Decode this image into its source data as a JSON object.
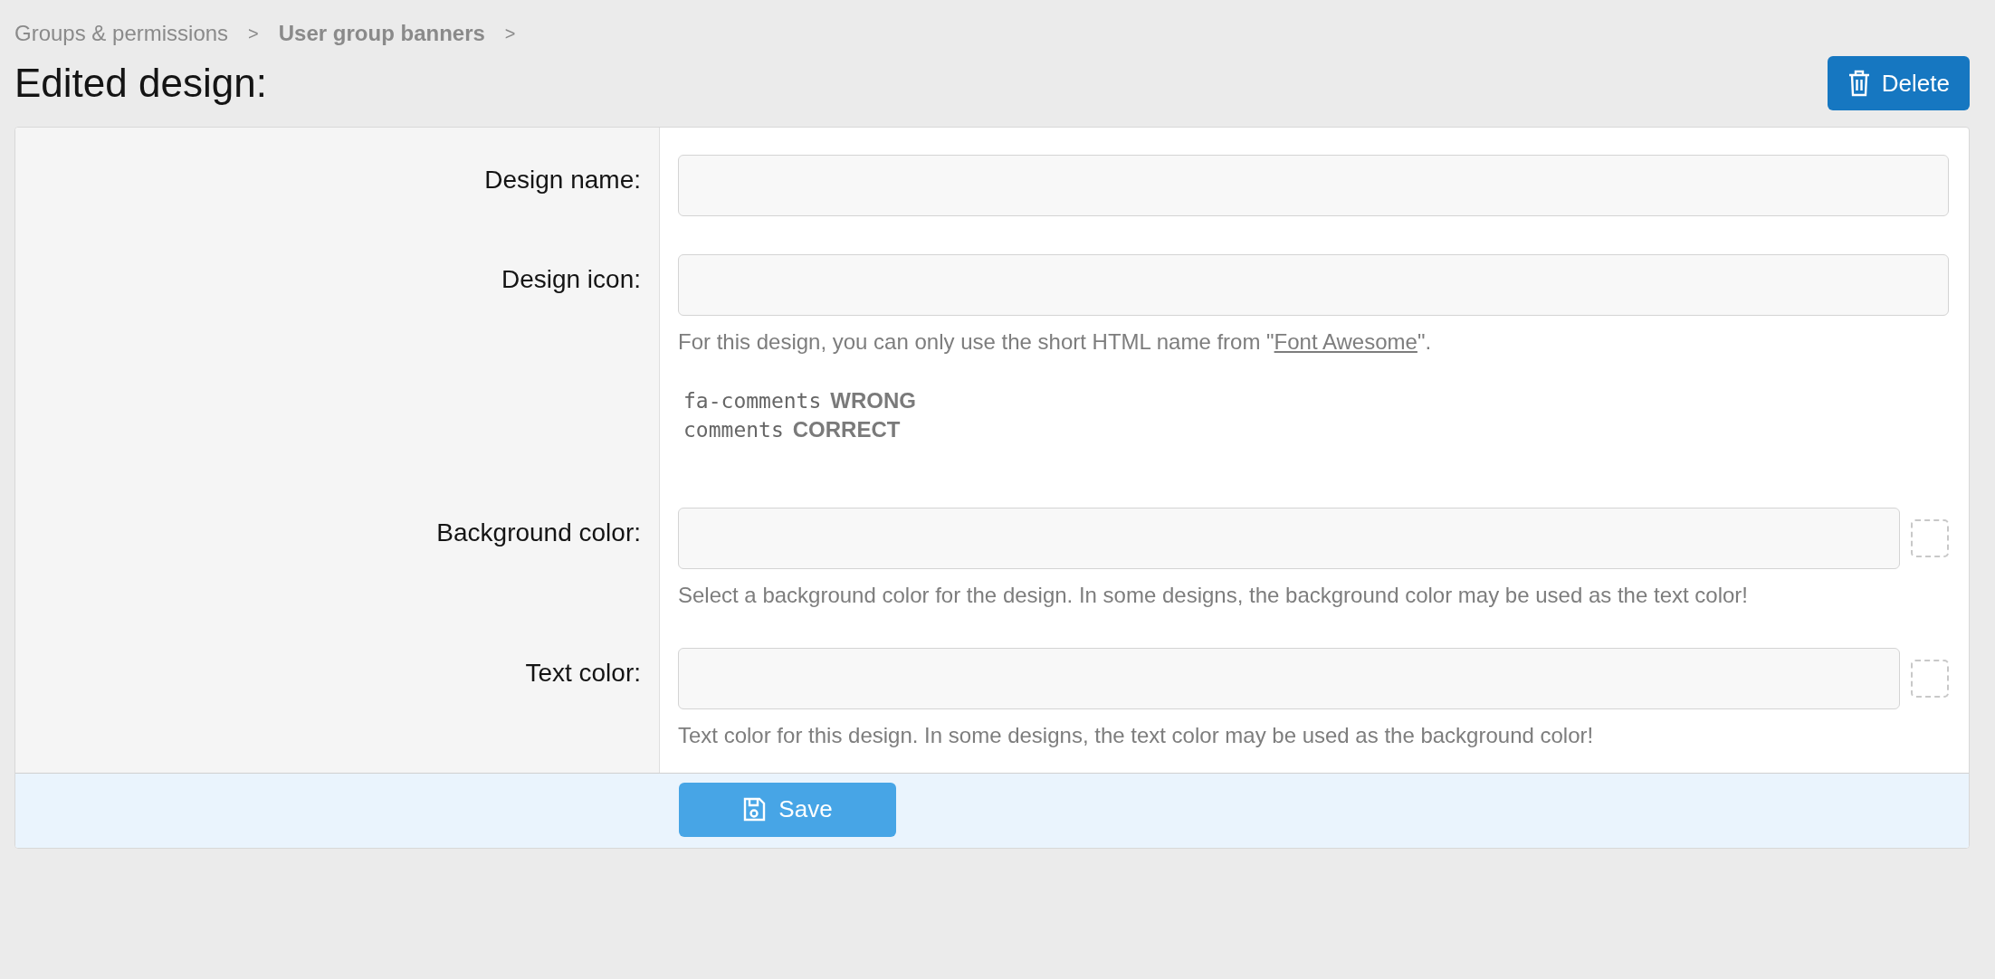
{
  "breadcrumbs": [
    {
      "label": "Groups & permissions",
      "current": false
    },
    {
      "label": "User group banners",
      "current": true
    }
  ],
  "breadcrumb_separator": ">",
  "title": "Edited design:",
  "delete_button": {
    "label": "Delete"
  },
  "rows": [
    {
      "kind": "text",
      "label": "Design name:"
    },
    {
      "kind": "text",
      "label": "Design icon:",
      "hint": {
        "before": "For this design, you can only use the short HTML name from \"",
        "link": "Font Awesome",
        "after": "\"."
      },
      "examples": [
        {
          "code": "fa-comments",
          "verdict": "WRONG"
        },
        {
          "code": "comments",
          "verdict": "CORRECT"
        }
      ]
    },
    {
      "kind": "color",
      "label": "Background color:",
      "hint": {
        "before": "Select a background color for the design. In some designs, the background color may be used as the text color!"
      }
    },
    {
      "kind": "color",
      "label": "Text color:",
      "hint": {
        "before": "Text color for this design. In some designs, the text color may be used as the background color!"
      }
    }
  ],
  "save_button": {
    "label": "Save"
  }
}
